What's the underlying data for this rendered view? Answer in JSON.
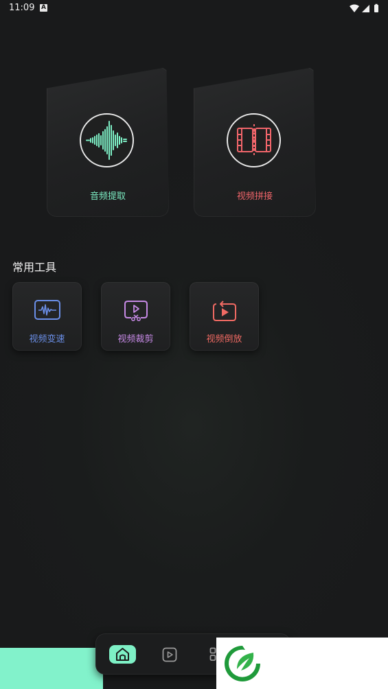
{
  "status_bar": {
    "time": "11:09",
    "notification_icon": "A"
  },
  "feature_cards": [
    {
      "label": "音频提取",
      "color": "#7ef0c6",
      "icon": "audio-waveform-icon"
    },
    {
      "label": "视频拼接",
      "color": "#f2666b",
      "icon": "film-strip-icon"
    }
  ],
  "section": {
    "title": "常用工具"
  },
  "tools": [
    {
      "label": "视频变速",
      "color": "#6b8fe8",
      "icon": "speed-wave-icon"
    },
    {
      "label": "视频裁剪",
      "color": "#c78ae6",
      "icon": "scissors-icon"
    },
    {
      "label": "视频倒放",
      "color": "#f06a63",
      "icon": "reverse-play-icon"
    }
  ],
  "bottom_nav": {
    "active_color": "#7ef0c6",
    "items": [
      "home-icon",
      "play-icon",
      "grid-icon"
    ]
  }
}
